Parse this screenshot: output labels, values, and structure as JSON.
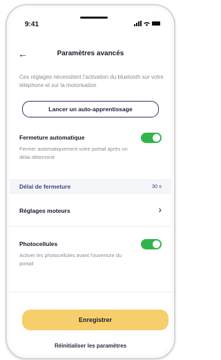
{
  "status": {
    "time": "9:41"
  },
  "header": {
    "title": "Paramètres avancés"
  },
  "description": "Ces réglages nécessitent l'activation du bluetooth sur votre téléphone et sur la motorisation",
  "autolearn_button": "Lancer un auto-apprentissage",
  "auto_close": {
    "title": "Fermeture automatique",
    "subtitle": "Fermer automatiquement votre portail après un délai déterminé",
    "enabled": true
  },
  "close_delay": {
    "label": "Délai de fermeture",
    "value": "30 s"
  },
  "motor_settings": {
    "label": "Réglages moteurs"
  },
  "photocells": {
    "title": "Photocellules",
    "subtitle": "Activer les photocellules avant l'ouverture du portail",
    "enabled": true
  },
  "save_button": "Enregistrer",
  "reset_link": "Réinitialiser les paramètres",
  "colors": {
    "toggle_on": "#30b54a",
    "primary": "#f6cf6c",
    "accent_navy": "#2e2e66",
    "side_accent": "#c49a55"
  }
}
